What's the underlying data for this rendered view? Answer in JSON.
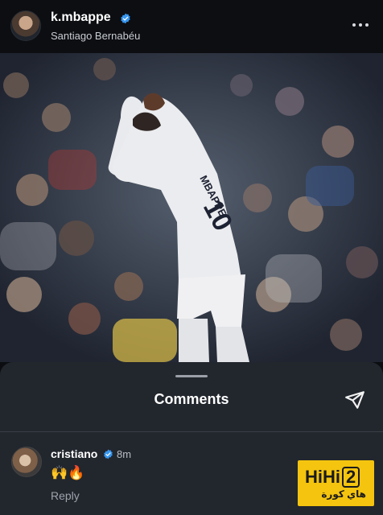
{
  "post": {
    "username": "k.mbappe",
    "location": "Santiago Bernabéu",
    "verified_icon": "verified-badge-icon",
    "more_icon": "more-options-icon"
  },
  "photo": {
    "jersey_name": "MBAPPE",
    "jersey_number": "10"
  },
  "comments_sheet": {
    "title": "Comments",
    "share_icon": "send-icon",
    "comments": [
      {
        "username": "cristiano",
        "time": "8m",
        "text": "🙌🔥",
        "reply_label": "Reply"
      }
    ]
  },
  "watermark": {
    "text": "HiHi",
    "number": "2",
    "arabic": "هاي كورة"
  },
  "colors": {
    "verified": "#3897f0",
    "accent_logo": "#f4c40f",
    "sheet_bg": "#22262d"
  }
}
